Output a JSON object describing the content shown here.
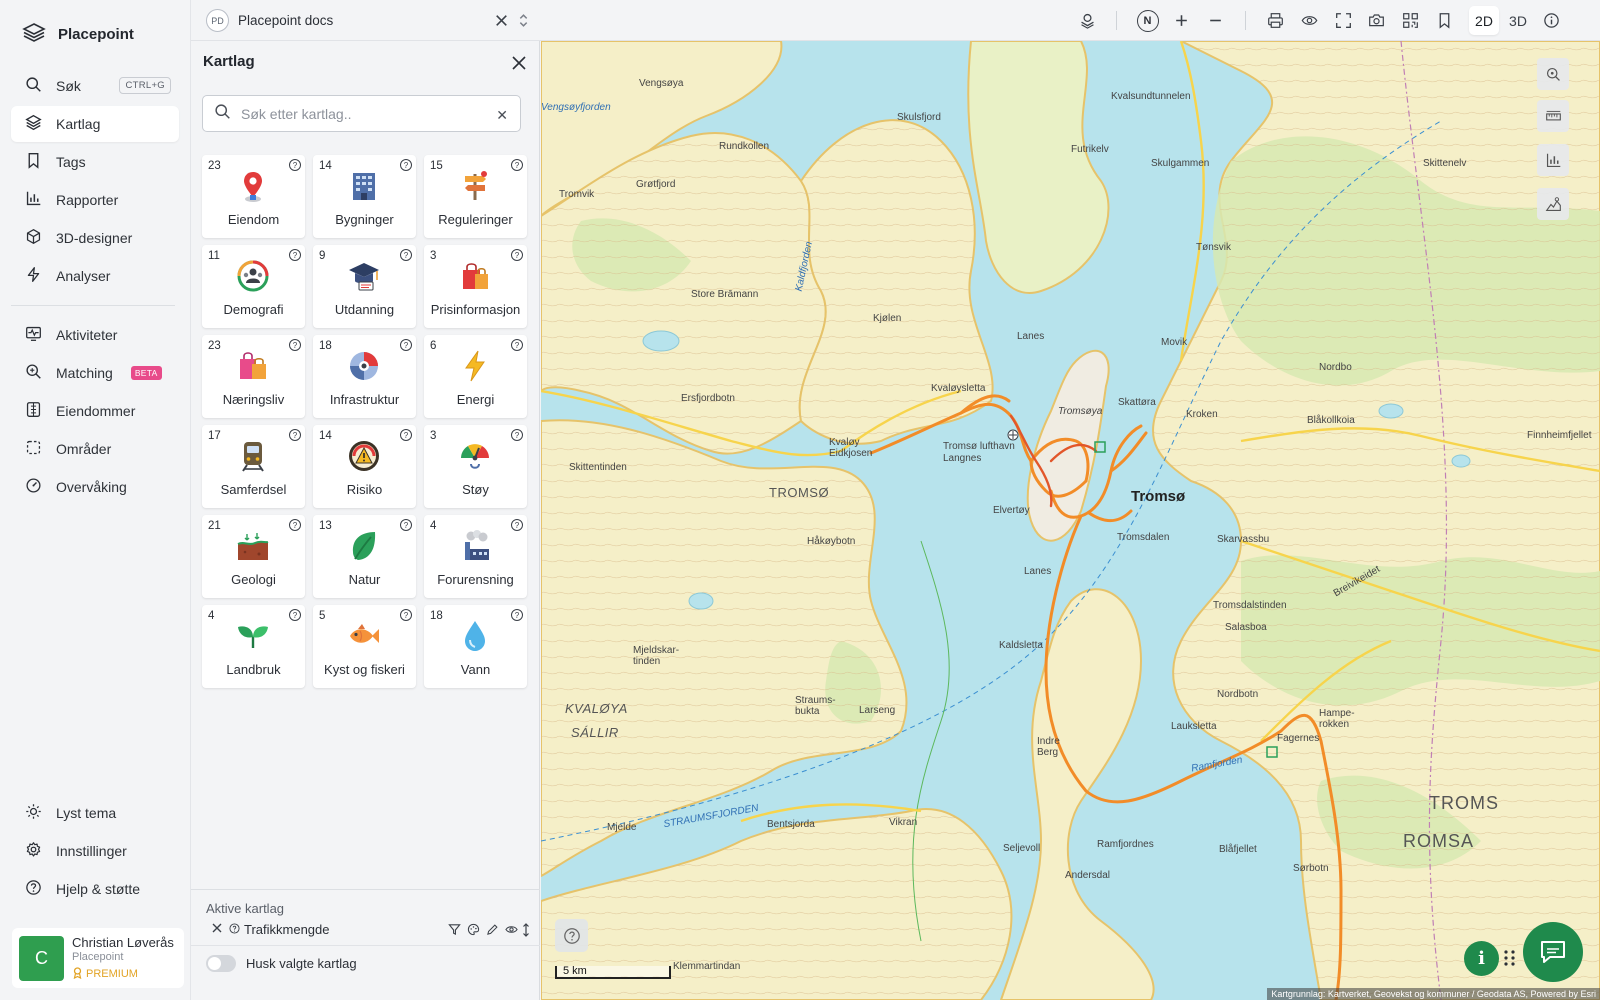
{
  "app": {
    "name": "Placepoint"
  },
  "sidebar": {
    "items": [
      {
        "label": "Søk",
        "shortcut": "CTRL+G",
        "icon": "search-icon"
      },
      {
        "label": "Kartlag",
        "icon": "layers-icon",
        "active": true
      },
      {
        "label": "Tags",
        "icon": "bookmark-icon"
      },
      {
        "label": "Rapporter",
        "icon": "bar-chart-icon"
      },
      {
        "label": "3D-designer",
        "icon": "cube-icon"
      },
      {
        "label": "Analyser",
        "icon": "lightning-icon"
      },
      {
        "label": "Aktiviteter",
        "icon": "activity-icon"
      },
      {
        "label": "Matching",
        "badge": "BETA",
        "icon": "search-plus-icon"
      },
      {
        "label": "Eiendommer",
        "icon": "building-icon"
      },
      {
        "label": "Områder",
        "icon": "area-icon"
      },
      {
        "label": "Overvåking",
        "icon": "gauge-icon"
      }
    ],
    "bottom_items": [
      {
        "label": "Lyst tema",
        "icon": "sun-icon"
      },
      {
        "label": "Innstillinger",
        "icon": "gear-icon"
      },
      {
        "label": "Hjelp & støtte",
        "icon": "help-icon"
      }
    ],
    "user": {
      "initial": "C",
      "name": "Christian Løverås",
      "org": "Placepoint",
      "plan": "PREMIUM"
    }
  },
  "topbar": {
    "doc_badge": "PD",
    "doc_title": "Placepoint docs",
    "north_label": "N",
    "mode_2d": "2D",
    "mode_3d": "3D",
    "active_mode": "2D"
  },
  "panel": {
    "title": "Kartlag",
    "search_placeholder": "Søk etter kartlag..",
    "help_glyph": "?",
    "layers": [
      {
        "count": "23",
        "label": "Eiendom",
        "icon": "map-pin-icon"
      },
      {
        "count": "14",
        "label": "Bygninger",
        "icon": "office-building-icon"
      },
      {
        "count": "15",
        "label": "Reguleringer",
        "icon": "signpost-icon"
      },
      {
        "count": "11",
        "label": "Demografi",
        "icon": "people-circle-icon"
      },
      {
        "count": "9",
        "label": "Utdanning",
        "icon": "graduation-cap-icon"
      },
      {
        "count": "3",
        "label": "Prisinformasjon",
        "icon": "shopping-bag-icon"
      },
      {
        "count": "23",
        "label": "Næringsliv",
        "icon": "shopping-bags-icon"
      },
      {
        "count": "18",
        "label": "Infrastruktur",
        "icon": "infrastructure-icon"
      },
      {
        "count": "6",
        "label": "Energi",
        "icon": "lightning-bolt-icon"
      },
      {
        "count": "17",
        "label": "Samferdsel",
        "icon": "train-icon"
      },
      {
        "count": "14",
        "label": "Risiko",
        "icon": "warning-gauge-icon"
      },
      {
        "count": "3",
        "label": "Støy",
        "icon": "noise-gauge-icon"
      },
      {
        "count": "21",
        "label": "Geologi",
        "icon": "soil-layers-icon"
      },
      {
        "count": "13",
        "label": "Natur",
        "icon": "leaf-icon"
      },
      {
        "count": "4",
        "label": "Forurensning",
        "icon": "factory-icon"
      },
      {
        "count": "4",
        "label": "Landbruk",
        "icon": "sprout-icon"
      },
      {
        "count": "5",
        "label": "Kyst og fiskeri",
        "icon": "fish-icon"
      },
      {
        "count": "18",
        "label": "Vann",
        "icon": "water-drop-icon"
      }
    ],
    "active_header": "Aktive kartlag",
    "active_layers": [
      {
        "name": "Trafikkmengde"
      }
    ],
    "remember_label": "Husk valgte kartlag"
  },
  "map": {
    "scale_label": "5 km",
    "attribution": "Kartgrunnlag: Kartverket, Geovekst og kommuner / Geodata AS, Powered by Esri",
    "labels": {
      "vengsoya": "Vengsøya",
      "vengsoyfjorden": "Vengsøyfjorden",
      "rundkollen": "Rundkollen",
      "grotfjord": "Grøtfjord",
      "tromvik": "Tromvik",
      "skulsfjord": "Skulsfjord",
      "kvalsundtunnelen": "Kvalsundtunnelen",
      "futrikelv": "Futrikelv",
      "skulgammen": "Skulgammen",
      "skittenelv": "Skittenelv",
      "kaldfjorden": "Kaldfjorden",
      "store_bramann": "Store Brāmann",
      "kjosen": "Kjølen",
      "tonsvik": "Tønsvik",
      "lanes_n": "Lanes",
      "movik": "Movik",
      "nordbo": "Nordbo",
      "ersfjordbotn": "Ersfjordbotn",
      "kvaloysletta": "Kvaløysletta",
      "skattora": "Skattøra",
      "kroken": "Kroken",
      "blakollkoia": "Blåkollkoia",
      "finnheimfjellet": "Finnheimfjellet",
      "tromsoya": "Tromsøya",
      "kvaloy_eidkjosen": "Kvaløy Eidkjosen",
      "lufthavn": "Tromsø lufthavn Langnes",
      "skittentinden": "Skittentinden",
      "tromso_muni": "TROMSØ",
      "tromso_city": "Tromsø",
      "elvertoy": "Elvertøy",
      "tromsdalen": "Tromsdalen",
      "hakoybotn": "Håkøybotn",
      "lanes_s": "Lanes",
      "skarvassbu": "Skarvassbu",
      "breivikeidet": "Breivikeidet",
      "tromsdalstinden": "Tromsdalstinden",
      "salasboa": "Salasboa",
      "kaldsletta": "Kaldsletta",
      "mjelde_tinden": "Mjeldskar-tinden",
      "straumsbukta": "Straums-bukta",
      "larseng": "Larseng",
      "nordbotn": "Nordbotn",
      "hamperokken": "Hampe-rokken",
      "kvaloya": "KVALØYA",
      "sallir": "SÁLLIR",
      "lauksletta": "Lauksletta",
      "indre_berg": "Indre Berg",
      "ramfjorden": "Ramfjorden",
      "fagernes": "Fagernes",
      "troms": "TROMS",
      "romsa": "ROMSA",
      "straumsfjorden": "STRAUMSFJORDEN",
      "mjelde": "Mjelde",
      "bentsjorda": "Bentsjorda",
      "vikran": "Vikran",
      "seljevoll": "Seljevoll",
      "ramfjordnes": "Ramfjordnes",
      "blafjellet": "Blåfjellet",
      "sorbotn": "Sørbotn",
      "andersdal": "Andersdal",
      "klemmartinden": "Klemmartindan"
    }
  },
  "colors": {
    "accent": "#1f8a4c",
    "beta": "#e84b8a",
    "premium": "#e2a325",
    "water": "#b7e3ec",
    "land": "#f5efc8",
    "road": "#f28c28"
  }
}
